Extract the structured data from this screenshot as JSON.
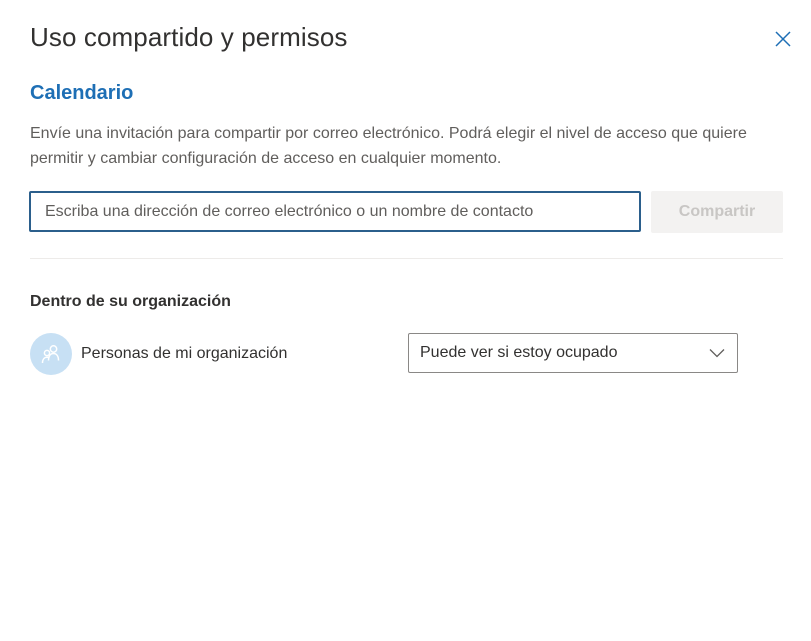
{
  "dialog": {
    "title": "Uso compartido y permisos",
    "close_icon": "close-icon"
  },
  "calendar": {
    "name": "Calendario",
    "description": "Envíe una invitación para compartir por correo electrónico. Podrá elegir el nivel de acceso que quiere permitir y cambiar configuración de acceso en cualquier momento."
  },
  "share": {
    "input_value": "",
    "input_placeholder": "Escriba una dirección de correo electrónico o un nombre de contacto",
    "button_label": "Compartir"
  },
  "organization": {
    "heading": "Dentro de su organización",
    "members": [
      {
        "name": "Personas de mi organización",
        "avatar_icon": "people-group-icon",
        "permission": "Puede ver si estoy ocupado",
        "dropdown_icon": "chevron-down-icon"
      }
    ]
  },
  "colors": {
    "accent": "#1e6fb5",
    "input_border": "#2b5f8c",
    "avatar_bg": "#c7e0f4",
    "disabled_button_bg": "#f3f2f1",
    "disabled_button_text": "#c8c6c4"
  }
}
